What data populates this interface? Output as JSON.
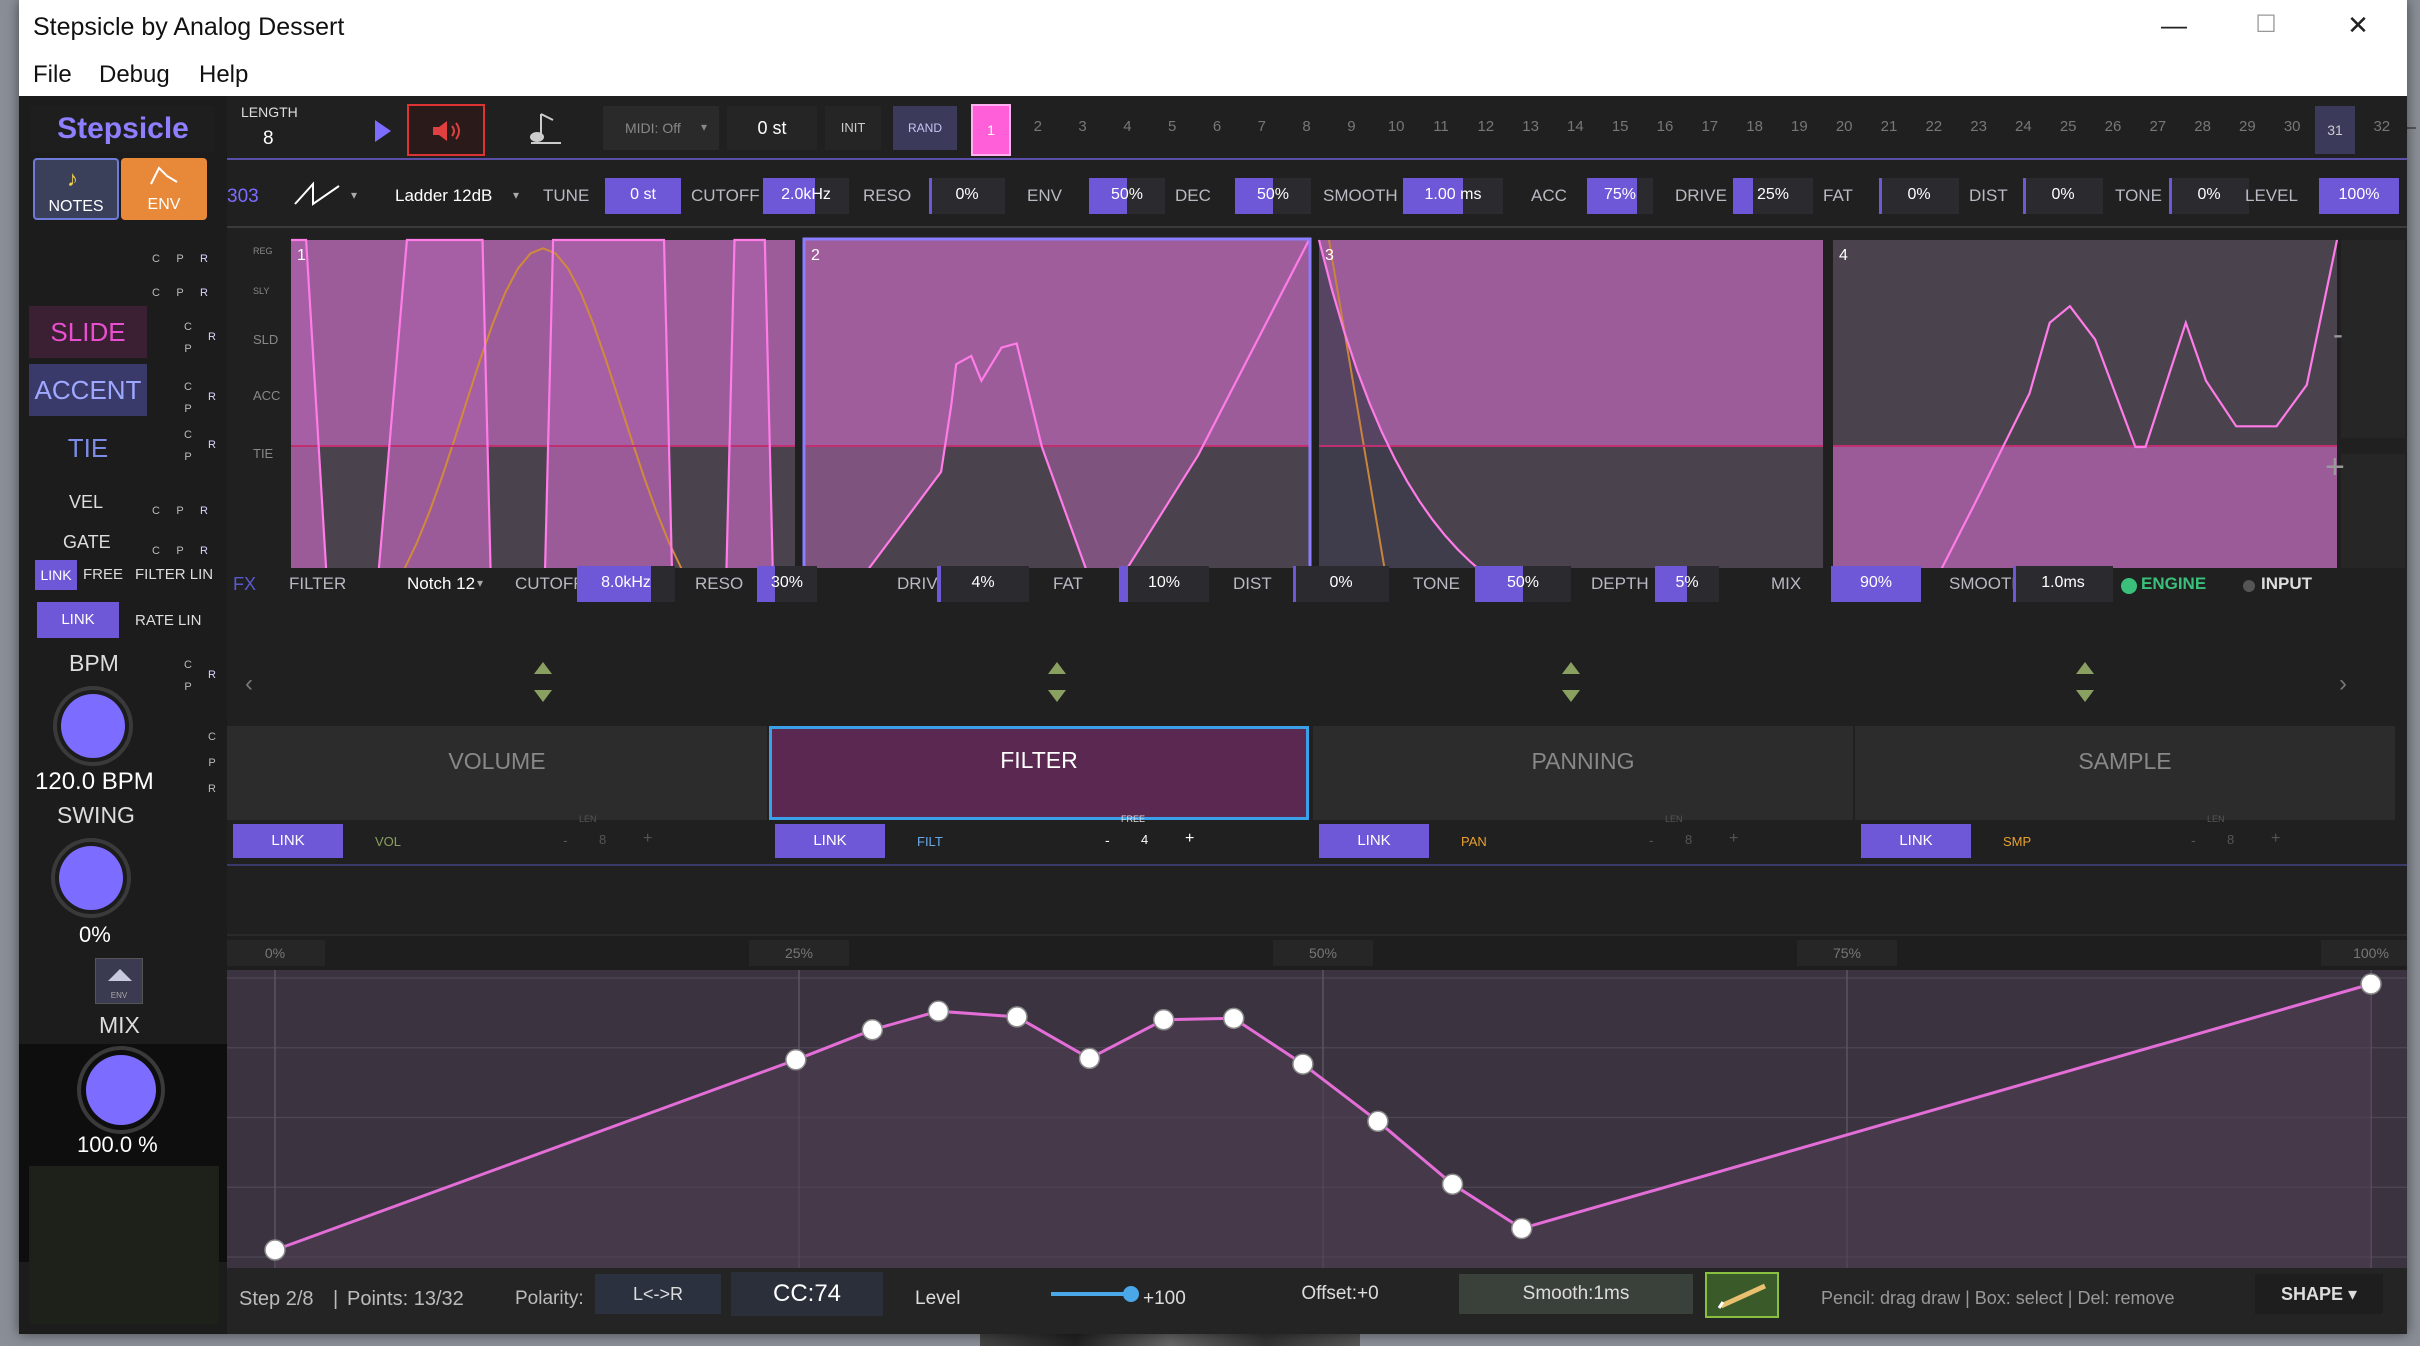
{
  "window": {
    "title": "Stepsicle by Analog Dessert",
    "minimize": "—",
    "maximize": "☐",
    "close": "✕"
  },
  "menu": [
    "File",
    "Debug",
    "Help"
  ],
  "brand": "Stepsicle",
  "modes": {
    "notes": "NOTES",
    "env": "ENV"
  },
  "top": {
    "length_label": "LENGTH",
    "length_value": "8",
    "midi": "MIDI: Off",
    "semitone": "0 st",
    "init": "INIT",
    "rand": "RAND"
  },
  "steps": [
    "1",
    "2",
    "3",
    "4",
    "5",
    "6",
    "7",
    "8",
    "9",
    "10",
    "11",
    "12",
    "13",
    "14",
    "15",
    "16",
    "17",
    "18",
    "19",
    "20",
    "21",
    "22",
    "23",
    "24",
    "25",
    "26",
    "27",
    "28",
    "29",
    "30",
    "31",
    "32"
  ],
  "synth": {
    "model": "303",
    "filter_type": "Ladder 12dB",
    "params": [
      {
        "label": "TUNE",
        "value": "0 st",
        "fill": 1
      },
      {
        "label": "CUTOFF",
        "value": "2.0kHz",
        "fill": 0.6
      },
      {
        "label": "RESO",
        "value": "0%",
        "fill": 0
      },
      {
        "label": "ENV",
        "value": "50%",
        "fill": 0.5
      },
      {
        "label": "DEC",
        "value": "50%",
        "fill": 0.5
      },
      {
        "label": "SMOOTH",
        "value": "1.00 ms",
        "fill": 0.6
      },
      {
        "label": "ACC",
        "value": "75%",
        "fill": 0.75
      },
      {
        "label": "DRIVE",
        "value": "25%",
        "fill": 0.25
      },
      {
        "label": "FAT",
        "value": "0%",
        "fill": 0
      },
      {
        "label": "DIST",
        "value": "0%",
        "fill": 0
      },
      {
        "label": "TONE",
        "value": "0%",
        "fill": 0
      },
      {
        "label": "LEVEL",
        "value": "100%",
        "fill": 1
      }
    ]
  },
  "left": {
    "slide": "SLIDE",
    "accent": "ACCENT",
    "tie": "TIE",
    "vel": "VEL",
    "gate": "GATE",
    "link": "LINK",
    "free": "FREE",
    "filter_lin": "FILTER LIN",
    "rate_lin": "RATE LIN",
    "bpm_label": "BPM",
    "bpm_value": "120.0 BPM",
    "swing_label": "SWING",
    "swing_value": "0%",
    "mix_label": "MIX",
    "mix_value": "100.0 %",
    "env_small": "ENV",
    "c": "C",
    "p": "P",
    "r": "R"
  },
  "row_labels": [
    "REG",
    "SLY",
    "SLD",
    "ACC",
    "TIE"
  ],
  "panels": [
    {
      "num": "1"
    },
    {
      "num": "2"
    },
    {
      "num": "3"
    },
    {
      "num": "4"
    }
  ],
  "side_minus": "-",
  "side_plus": "+",
  "tabs": [
    {
      "name": "VOLUME",
      "link": "LINK",
      "tag": "VOL",
      "small": "LEN",
      "count": "8",
      "active": false
    },
    {
      "name": "FILTER",
      "link": "LINK",
      "tag": "FILT",
      "small": "FREE",
      "count": "4",
      "active": true
    },
    {
      "name": "PANNING",
      "link": "LINK",
      "tag": "PAN",
      "small": "LEN",
      "count": "8",
      "active": false
    },
    {
      "name": "SAMPLE",
      "link": "LINK",
      "tag": "SMP",
      "small": "LEN",
      "count": "8",
      "active": false
    }
  ],
  "minus": "-",
  "plus": "+",
  "fx": {
    "label": "FX",
    "filter_label": "FILTER",
    "filter_type": "Notch 12",
    "params": [
      {
        "label": "CUTOFF",
        "value": "8.0kHz",
        "fill": 0.75
      },
      {
        "label": "RESO",
        "value": "30%",
        "fill": 0.3
      },
      {
        "label": "DRIVE",
        "value": "4%",
        "fill": 0.04
      },
      {
        "label": "FAT",
        "value": "10%",
        "fill": 0.1
      },
      {
        "label": "DIST",
        "value": "0%",
        "fill": 0
      },
      {
        "label": "TONE",
        "value": "50%",
        "fill": 0.5
      },
      {
        "label": "DEPTH",
        "value": "5%",
        "fill": 0.5
      },
      {
        "label": "MIX",
        "value": "90%",
        "fill": 1
      },
      {
        "label": "SMOOTH",
        "value": "1.0ms",
        "fill": 0
      }
    ],
    "engine": "ENGINE",
    "input": "INPUT"
  },
  "ruler": [
    "0%",
    "25%",
    "50%",
    "75%",
    "100%"
  ],
  "env_points": [
    [
      0,
      0.07
    ],
    [
      0.2485,
      0.735
    ],
    [
      0.285,
      0.84
    ],
    [
      0.3165,
      0.905
    ],
    [
      0.354,
      0.885
    ],
    [
      0.3886,
      0.74
    ],
    [
      0.424,
      0.875
    ],
    [
      0.4574,
      0.88
    ],
    [
      0.4904,
      0.72
    ],
    [
      0.5262,
      0.52
    ],
    [
      0.5618,
      0.3
    ],
    [
      0.5948,
      0.145
    ],
    [
      1,
      1
    ]
  ],
  "status": {
    "step": "Step 2/8",
    "points": "Points: 13/32",
    "polarity_label": "Polarity:",
    "polarity": "L<->R",
    "cc": "CC:74",
    "level_label": "Level",
    "level_value": "+100",
    "offset": "Offset:+0",
    "smooth": "Smooth:1ms",
    "hint": "Pencil: drag draw | Box: select | Del: remove",
    "shape": "SHAPE ▾"
  }
}
